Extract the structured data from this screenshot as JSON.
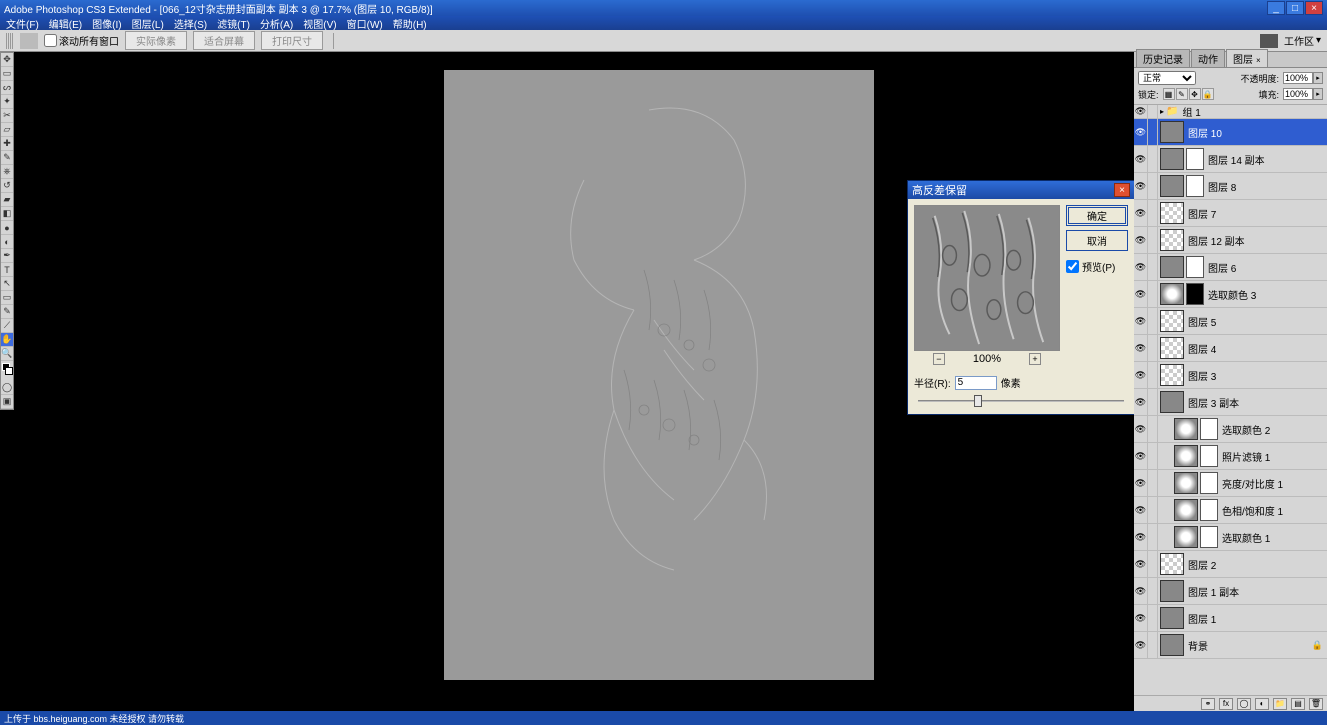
{
  "titlebar": {
    "title": "Adobe Photoshop CS3 Extended - [066_12寸杂志册封面副本 副本 3 @ 17.7% (图层 10, RGB/8)]"
  },
  "menu": {
    "file": "文件(F)",
    "edit": "编辑(E)",
    "image": "图像(I)",
    "layer": "图层(L)",
    "select": "选择(S)",
    "filter": "滤镜(T)",
    "analysis": "分析(A)",
    "view": "视图(V)",
    "window": "窗口(W)",
    "help": "帮助(H)"
  },
  "optbar": {
    "scrollAll": "滚动所有窗口",
    "actualPixels": "实际像素",
    "fitScreen": "适合屏幕",
    "printSize": "打印尺寸",
    "workspace": "工作区"
  },
  "dialog": {
    "title": "高反差保留",
    "ok": "确定",
    "cancel": "取消",
    "preview": "预览(P)",
    "zoom": "100%",
    "radiusLabel": "半径(R):",
    "radiusValue": "5",
    "radiusUnit": "像素"
  },
  "panels": {
    "tabs": {
      "history": "历史记录",
      "actions": "动作",
      "layers": "图层"
    },
    "blend": "正常",
    "opacityLabel": "不透明度:",
    "opacityVal": "100%",
    "lockLabel": "锁定:",
    "fillLabel": "填充:",
    "fillVal": "100%"
  },
  "layers": [
    {
      "type": "group",
      "name": "组 1"
    },
    {
      "type": "layer",
      "name": "图层 10",
      "thumb": "th-gray",
      "sel": true
    },
    {
      "type": "layer",
      "name": "图层 14 副本",
      "thumb": "th-dark",
      "mask": "white"
    },
    {
      "type": "layer",
      "name": "图层 8",
      "thumb": "th-dark",
      "mask": "white"
    },
    {
      "type": "layer",
      "name": "图层 7",
      "thumb": "trans"
    },
    {
      "type": "layer",
      "name": "图层 12 副本",
      "thumb": "trans"
    },
    {
      "type": "layer",
      "name": "图层 6",
      "thumb": "th-dark",
      "mask": "white"
    },
    {
      "type": "adj",
      "name": "选取颜色 3",
      "mask": "dark"
    },
    {
      "type": "layer",
      "name": "图层 5",
      "thumb": "trans"
    },
    {
      "type": "layer",
      "name": "图层 4",
      "thumb": "trans"
    },
    {
      "type": "layer",
      "name": "图层 3",
      "thumb": "trans"
    },
    {
      "type": "layer",
      "name": "图层 3 副本",
      "thumb": "th-photo"
    },
    {
      "type": "adj",
      "name": "选取颜色 2",
      "mask": "white",
      "indent": 1
    },
    {
      "type": "adj",
      "name": "照片滤镜 1",
      "mask": "white",
      "indent": 1
    },
    {
      "type": "adj",
      "name": "亮度/对比度 1",
      "mask": "white",
      "indent": 1
    },
    {
      "type": "adj",
      "name": "色相/饱和度 1",
      "mask": "white",
      "indent": 1
    },
    {
      "type": "adj",
      "name": "选取颜色 1",
      "mask": "white",
      "indent": 1
    },
    {
      "type": "layer",
      "name": "图层 2",
      "thumb": "trans"
    },
    {
      "type": "layer",
      "name": "图层 1 副本",
      "thumb": "th-color"
    },
    {
      "type": "layer",
      "name": "图层 1",
      "thumb": "th-color"
    },
    {
      "type": "bg",
      "name": "背景",
      "thumb": "th-color",
      "locked": true
    }
  ],
  "statusbar": "上传于 bbs.heiguang.com 未经授权 请勿转载"
}
